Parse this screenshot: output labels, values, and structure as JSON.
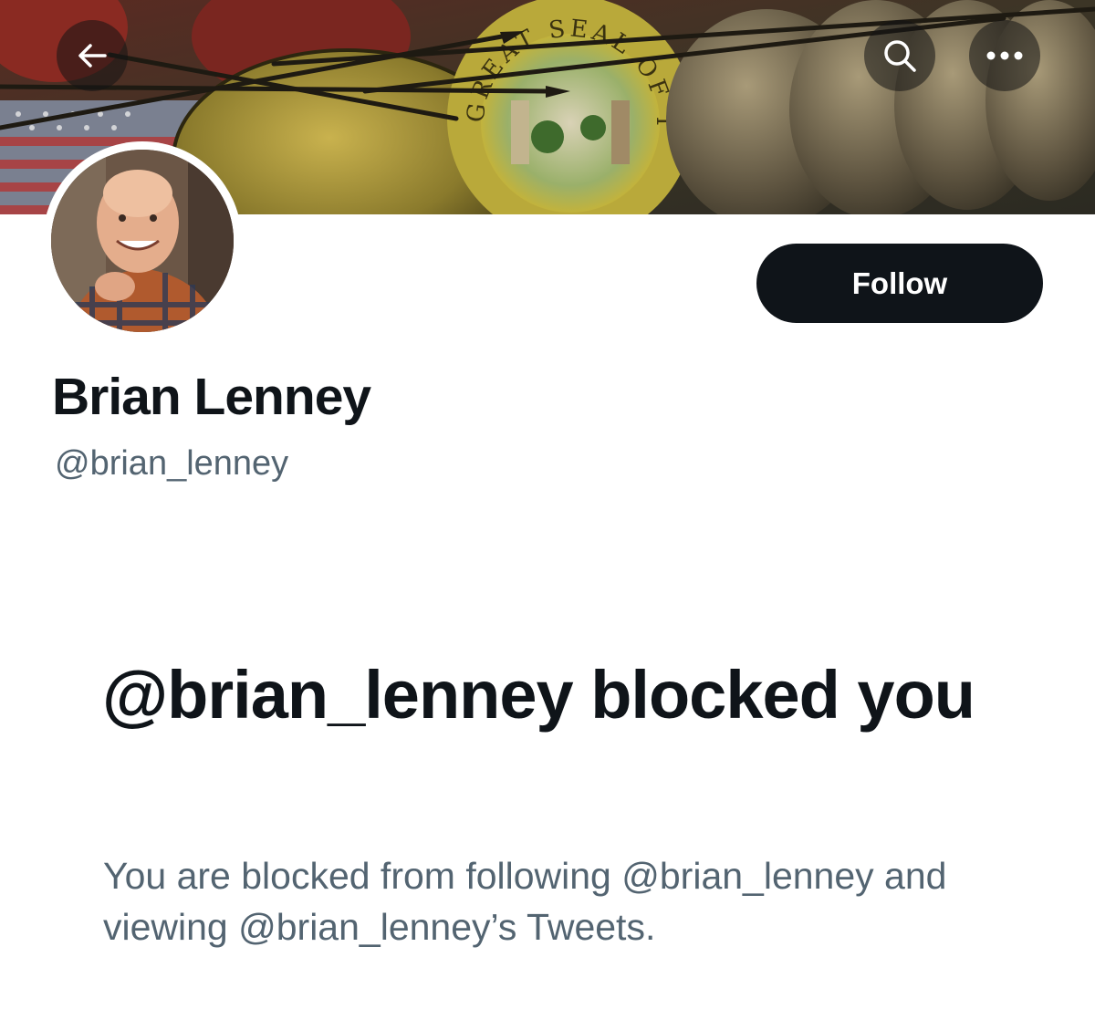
{
  "header": {
    "back_icon": "arrow-left-icon",
    "search_icon": "search-icon",
    "more_icon": "more-horizontal-icon",
    "banner_seal_text": "GREAT SEAL OF THE STATE OF IDAHO"
  },
  "profile": {
    "name": "Brian Lenney",
    "handle": "@brian_lenney",
    "follow_label": "Follow"
  },
  "blocked": {
    "title": "@brian_lenney blocked you",
    "description": "You are blocked from following @brian_lenney and viewing @brian_lenney’s Tweets."
  },
  "colors": {
    "primary_text": "#0f1419",
    "secondary_text": "#536471",
    "follow_bg": "#0f1419",
    "follow_text": "#ffffff"
  }
}
